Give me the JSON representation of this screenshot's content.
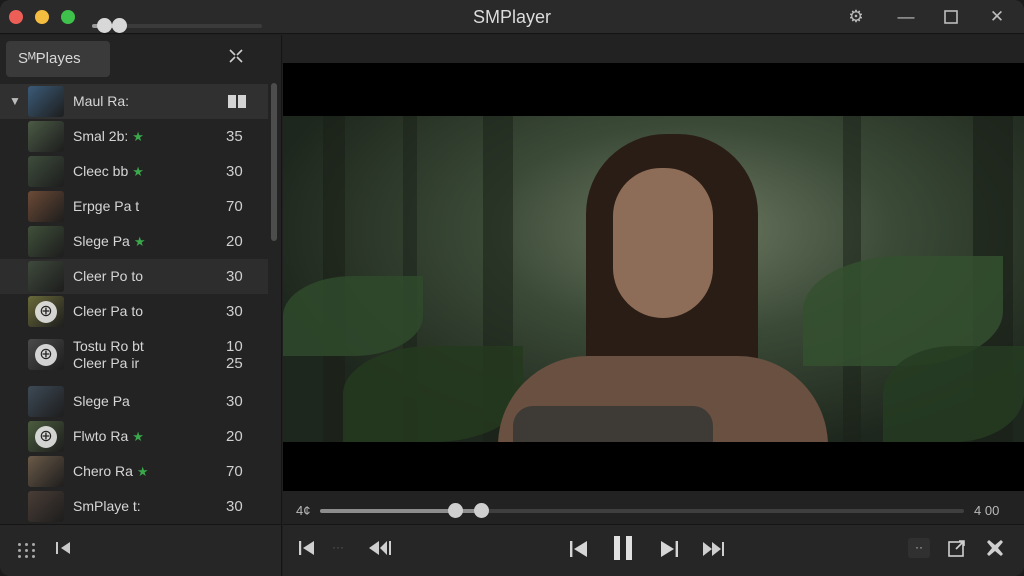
{
  "window": {
    "title": "SMPlayer"
  },
  "colors": {
    "close": "#ed5e57",
    "minimize": "#f4bd3f",
    "maximize": "#3fc24c",
    "star": "#3aa84b"
  },
  "titlebar": {
    "settings_icon": "gear-icon",
    "minimize_icon": "minimize-icon",
    "maximize_icon": "maximize-icon",
    "close_icon": "close-icon"
  },
  "sidebar": {
    "tab_label": "SᴹPlayes",
    "collapse_icon": "collapse-icon",
    "playlist": [
      {
        "name": "Maul Ra:",
        "count": "",
        "star": false,
        "expanded": true,
        "active": true
      },
      {
        "name": "Smal 2b:",
        "count": "35",
        "star": true
      },
      {
        "name": "Cleec bb",
        "count": "30",
        "star": true
      },
      {
        "name": "Erpge Pa t",
        "count": "70",
        "star": false
      },
      {
        "name": "Slege Pa",
        "count": "20",
        "star": true
      },
      {
        "name": "Cleer Po to",
        "count": "30",
        "star": false,
        "hover": true
      },
      {
        "name": "Cleer Pa to",
        "count": "30",
        "star": false
      },
      {
        "name": "Tostu Ro bt",
        "name2": "Cleer Pa ir",
        "count": "10",
        "count2": "25",
        "star": false
      },
      {
        "name": "Slege Pa",
        "count": "30",
        "star": false
      },
      {
        "name": "Flwto Ra",
        "count": "20",
        "star": true
      },
      {
        "name": "Chero Ra",
        "count": "70",
        "star": true
      },
      {
        "name": "SmPlaye t:",
        "count": "30",
        "star": false
      }
    ],
    "volume_level": 0.16
  },
  "player": {
    "time_left": "4¢",
    "time_right": "4 00",
    "progress_fraction": 0.25,
    "buffer_fraction": 0.21
  },
  "controls": {
    "prev_icon": "skip-back-icon",
    "stop_icon": "stop-icon",
    "rewind_icon": "rewind-icon",
    "pause_icon": "pause-icon",
    "next_icon": "skip-forward-icon",
    "forward_icon": "fast-forward-icon",
    "more_label": "··",
    "share_icon": "share-icon",
    "fullscreen_icon": "fullscreen-icon"
  }
}
